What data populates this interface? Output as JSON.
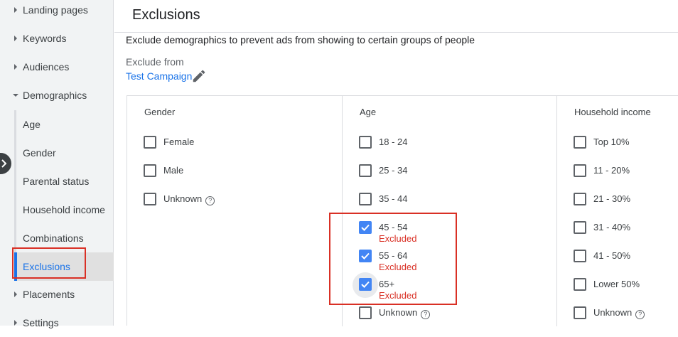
{
  "sidebar": {
    "items": [
      {
        "label": "Landing pages",
        "expanded": false
      },
      {
        "label": "Keywords",
        "expanded": false
      },
      {
        "label": "Audiences",
        "expanded": false
      },
      {
        "label": "Demographics",
        "expanded": true
      },
      {
        "label": "Placements",
        "expanded": false
      },
      {
        "label": "Settings",
        "expanded": false
      }
    ],
    "demographics_sub": [
      "Age",
      "Gender",
      "Parental status",
      "Household income",
      "Combinations",
      "Exclusions"
    ],
    "active": "Exclusions"
  },
  "header": {
    "title": "Exclusions"
  },
  "description": "Exclude demographics to prevent ads from showing to certain groups of people",
  "exclude_from": {
    "label": "Exclude from",
    "campaign": "Test Campaign"
  },
  "columns": {
    "gender": {
      "title": "Gender",
      "options": [
        {
          "label": "Female",
          "checked": false
        },
        {
          "label": "Male",
          "checked": false
        },
        {
          "label": "Unknown",
          "checked": false,
          "help": true
        }
      ]
    },
    "age": {
      "title": "Age",
      "options": [
        {
          "label": "18 - 24",
          "checked": false
        },
        {
          "label": "25 - 34",
          "checked": false
        },
        {
          "label": "35 - 44",
          "checked": false
        },
        {
          "label": "45 - 54",
          "checked": true,
          "status": "Excluded"
        },
        {
          "label": "55 - 64",
          "checked": true,
          "status": "Excluded"
        },
        {
          "label": "65+",
          "checked": true,
          "status": "Excluded"
        },
        {
          "label": "Unknown",
          "checked": false,
          "help": true
        }
      ]
    },
    "income": {
      "title": "Household income",
      "options": [
        {
          "label": "Top 10%",
          "checked": false
        },
        {
          "label": "11 - 20%",
          "checked": false
        },
        {
          "label": "21 - 30%",
          "checked": false
        },
        {
          "label": "31 - 40%",
          "checked": false
        },
        {
          "label": "41 - 50%",
          "checked": false
        },
        {
          "label": "Lower 50%",
          "checked": false
        },
        {
          "label": "Unknown",
          "checked": false,
          "help": true
        }
      ]
    }
  },
  "help_glyph": "?",
  "colors": {
    "accent": "#1a73e8",
    "checkbox": "#4285f4",
    "excluded": "#d93025",
    "highlight_box": "#d93025"
  }
}
